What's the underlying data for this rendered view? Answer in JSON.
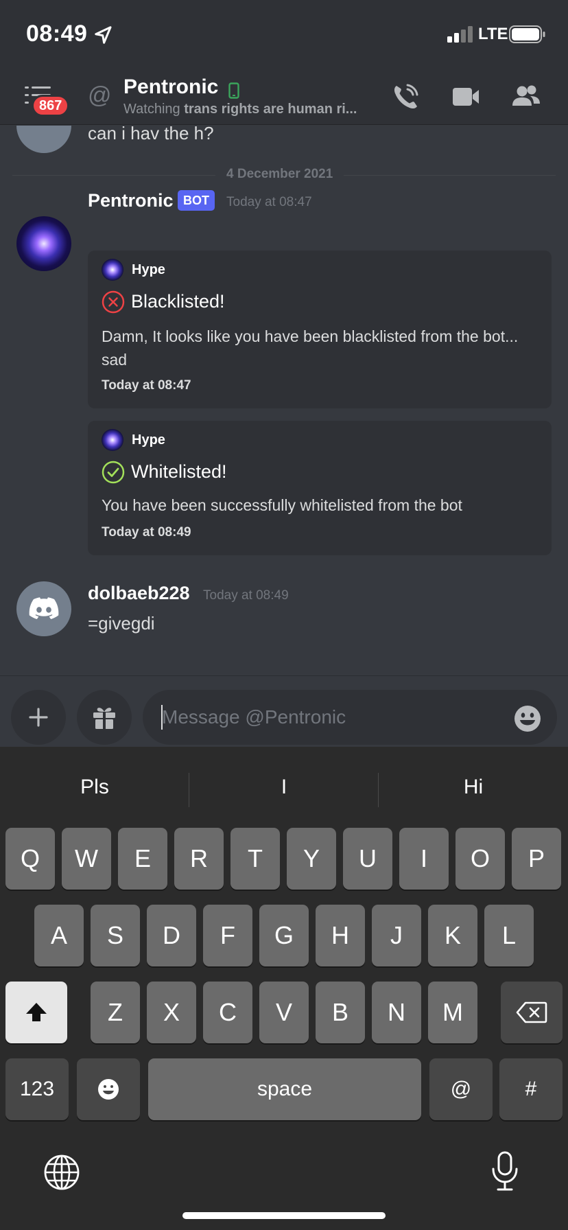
{
  "status_bar": {
    "time": "08:49",
    "network": "LTE",
    "icons": [
      "location-arrow-icon",
      "signal-bars-icon",
      "battery-icon"
    ]
  },
  "header": {
    "unread_badge": "867",
    "channel_name": "Pentronic",
    "status_prefix": "Watching ",
    "status_activity": "trans rights are human ri...",
    "icons": [
      "menu-icon",
      "at-icon",
      "mobile-icon",
      "call-icon",
      "video-icon",
      "members-icon"
    ]
  },
  "chat": {
    "previous_message": "can i hav the h?",
    "date_divider": "4 December 2021",
    "messages": [
      {
        "author": "Pentronic",
        "tag": "BOT",
        "timestamp": "Today at 08:47",
        "embeds": [
          {
            "author": "Hype",
            "title": "Blacklisted!",
            "title_icon": "x-circle-icon",
            "description": "Damn, It looks like you have been blacklisted from the bot... sad",
            "footer": "Today at 08:47"
          },
          {
            "author": "Hype",
            "title": "Whitelisted!",
            "title_icon": "check-circle-icon",
            "description": "You have been successfully whitelisted from the bot",
            "footer": "Today at 08:49"
          }
        ]
      },
      {
        "author": "dolbaeb228",
        "timestamp": "Today at 08:49",
        "text": "=givegdi"
      }
    ]
  },
  "composer": {
    "placeholder": "Message @Pentronic",
    "value": ""
  },
  "keyboard": {
    "suggestions": [
      "Pls",
      "I",
      "Hi"
    ],
    "row1": [
      "Q",
      "W",
      "E",
      "R",
      "T",
      "Y",
      "U",
      "I",
      "O",
      "P"
    ],
    "row2": [
      "A",
      "S",
      "D",
      "F",
      "G",
      "H",
      "J",
      "K",
      "L"
    ],
    "row3": [
      "Z",
      "X",
      "C",
      "V",
      "B",
      "N",
      "M"
    ],
    "numbers_label": "123",
    "space_label": "space",
    "at_label": "@",
    "hash_label": "#"
  },
  "colors": {
    "background": "#36393f",
    "header": "#2f3136",
    "embed": "#2f3136",
    "blurple": "#5865f2",
    "badge_red": "#ed4245",
    "error_icon": "#ed4245",
    "success_icon": "#a3e05a",
    "online_green": "#3ba55c"
  }
}
